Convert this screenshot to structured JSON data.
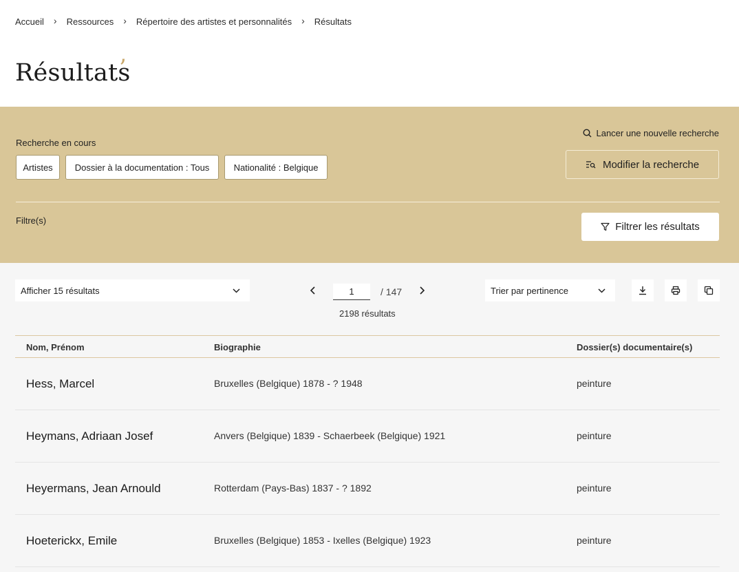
{
  "breadcrumb": {
    "items": [
      "Accueil",
      "Ressources",
      "Répertoire des artistes et personnalités",
      "Résultats"
    ]
  },
  "page": {
    "title": "Résultats"
  },
  "search": {
    "current_label": "Recherche en cours",
    "chips": [
      "Artistes",
      "Dossier à la documentation : Tous",
      "Nationalité : Belgique"
    ],
    "new_search": "Lancer une nouvelle recherche",
    "modify": "Modifier la recherche",
    "filters_label": "Filtre(s)",
    "filter_button": "Filtrer les résultats"
  },
  "results": {
    "per_page": "Afficher 15 résultats",
    "page_current": "1",
    "page_total": "/ 147",
    "count": "2198 résultats",
    "sort": "Trier par pertinence",
    "columns": [
      "Nom, Prénom",
      "Biographie",
      "Dossier(s) documentaire(s)"
    ],
    "rows": [
      {
        "name": "Hess, Marcel",
        "bio": "Bruxelles (Belgique) 1878 - ? 1948",
        "doc": "peinture"
      },
      {
        "name": "Heymans, Adriaan Josef",
        "bio": "Anvers (Belgique) 1839 - Schaerbeek (Belgique) 1921",
        "doc": "peinture"
      },
      {
        "name": "Heyermans, Jean Arnould",
        "bio": "Rotterdam (Pays-Bas) 1837 - ? 1892",
        "doc": "peinture"
      },
      {
        "name": "Hoeterickx, Emile",
        "bio": "Bruxelles (Belgique) 1853 - Ixelles (Belgique) 1923",
        "doc": "peinture"
      }
    ]
  },
  "colors": {
    "band": "#d9c698",
    "accent": "#c9a86b",
    "results_bg": "#f6f6f6"
  },
  "icons": {
    "breadcrumb_separator": "chevron-right-icon",
    "new_search": "search-icon",
    "modify": "search-list-icon",
    "filter": "funnel-icon",
    "per_page": "chevron-down-icon",
    "prev": "chevron-left-icon",
    "next": "chevron-right-icon",
    "download": "download-icon",
    "print": "printer-icon",
    "copy": "copy-icon"
  }
}
